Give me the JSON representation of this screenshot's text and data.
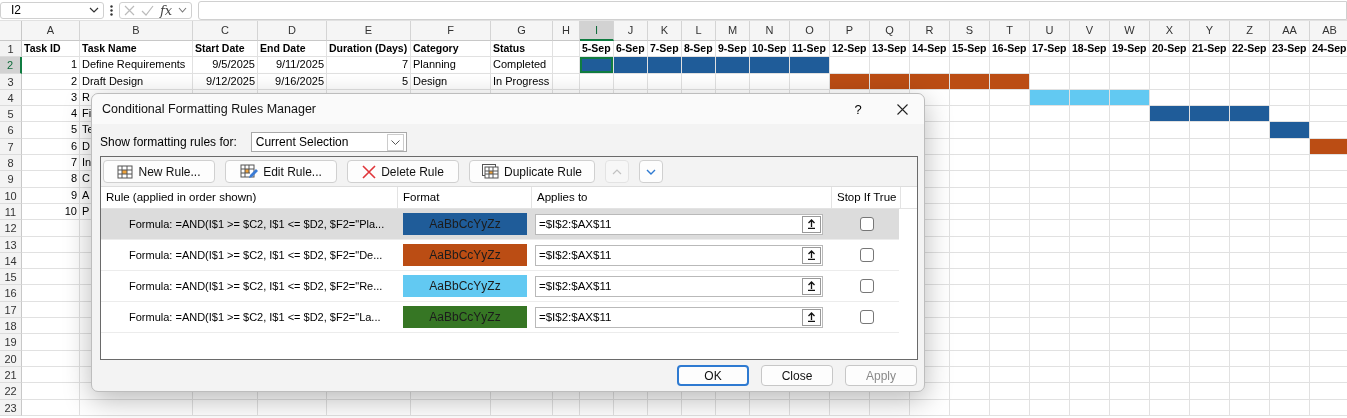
{
  "name_box": {
    "value": "I2"
  },
  "formula_bar": {
    "function_label": "fx"
  },
  "columns": [
    {
      "label": "A",
      "selected": false
    },
    {
      "label": "B",
      "selected": false
    },
    {
      "label": "C",
      "selected": false
    },
    {
      "label": "D",
      "selected": false
    },
    {
      "label": "E",
      "selected": false
    },
    {
      "label": "F",
      "selected": false
    },
    {
      "label": "G",
      "selected": false
    },
    {
      "label": "H",
      "selected": false
    },
    {
      "label": "I",
      "selected": true
    },
    {
      "label": "J",
      "selected": false
    },
    {
      "label": "K",
      "selected": false
    },
    {
      "label": "L",
      "selected": false
    },
    {
      "label": "M",
      "selected": false
    },
    {
      "label": "N",
      "selected": false
    },
    {
      "label": "O",
      "selected": false
    },
    {
      "label": "P",
      "selected": false
    },
    {
      "label": "Q",
      "selected": false
    },
    {
      "label": "R",
      "selected": false
    },
    {
      "label": "S",
      "selected": false
    },
    {
      "label": "T",
      "selected": false
    },
    {
      "label": "U",
      "selected": false
    },
    {
      "label": "V",
      "selected": false
    },
    {
      "label": "W",
      "selected": false
    },
    {
      "label": "X",
      "selected": false
    },
    {
      "label": "Y",
      "selected": false
    },
    {
      "label": "Z",
      "selected": false
    },
    {
      "label": "AA",
      "selected": false
    },
    {
      "label": "AB",
      "selected": false
    }
  ],
  "rows": [
    {
      "number": "1",
      "selected": false,
      "cells": [
        {
          "text": "Task ID",
          "kind": "header"
        },
        {
          "text": "Task Name",
          "kind": "header"
        },
        {
          "text": "Start Date",
          "kind": "header"
        },
        {
          "text": "End Date",
          "kind": "header"
        },
        {
          "text": "Duration (Days)",
          "kind": "header"
        },
        {
          "text": "Category",
          "kind": "header"
        },
        {
          "text": "Status",
          "kind": "header"
        },
        null,
        {
          "text": "5-Sep",
          "kind": "header"
        },
        {
          "text": "6-Sep",
          "kind": "header"
        },
        {
          "text": "7-Sep",
          "kind": "header"
        },
        {
          "text": "8-Sep",
          "kind": "header"
        },
        {
          "text": "9-Sep",
          "kind": "header"
        },
        {
          "text": "10-Sep",
          "kind": "header"
        },
        {
          "text": "11-Sep",
          "kind": "header"
        },
        {
          "text": "12-Sep",
          "kind": "header"
        },
        {
          "text": "13-Sep",
          "kind": "header"
        },
        {
          "text": "14-Sep",
          "kind": "header"
        },
        {
          "text": "15-Sep",
          "kind": "header"
        },
        {
          "text": "16-Sep",
          "kind": "header"
        },
        {
          "text": "17-Sep",
          "kind": "header"
        },
        {
          "text": "18-Sep",
          "kind": "header"
        },
        {
          "text": "19-Sep",
          "kind": "header"
        },
        {
          "text": "20-Sep",
          "kind": "header"
        },
        {
          "text": "21-Sep",
          "kind": "header"
        },
        {
          "text": "22-Sep",
          "kind": "header"
        },
        {
          "text": "23-Sep",
          "kind": "header"
        },
        {
          "text": "24-Sep",
          "kind": "header"
        }
      ]
    },
    {
      "number": "2",
      "selected": true,
      "cells": [
        {
          "text": "1",
          "kind": "number"
        },
        {
          "text": "Define Requirements",
          "kind": "text"
        },
        {
          "text": "9/5/2025",
          "kind": "number"
        },
        {
          "text": "9/11/2025",
          "kind": "number"
        },
        {
          "text": "7",
          "kind": "number"
        },
        {
          "text": "Planning",
          "kind": "text"
        },
        {
          "text": "Completed",
          "kind": "text"
        },
        null,
        {
          "color": "#1f5c99"
        },
        {
          "color": "#1f5c99"
        },
        {
          "color": "#1f5c99"
        },
        {
          "color": "#1f5c99"
        },
        {
          "color": "#1f5c99"
        },
        {
          "color": "#1f5c99"
        },
        {
          "color": "#1f5c99"
        }
      ]
    },
    {
      "number": "3",
      "selected": false,
      "cells": [
        {
          "text": "2",
          "kind": "number"
        },
        {
          "text": "Draft Design",
          "kind": "text"
        },
        {
          "text": "9/12/2025",
          "kind": "number"
        },
        {
          "text": "9/16/2025",
          "kind": "number"
        },
        {
          "text": "5",
          "kind": "number"
        },
        {
          "text": "Design",
          "kind": "text"
        },
        {
          "text": "In Progress",
          "kind": "text"
        },
        null,
        null,
        null,
        null,
        null,
        null,
        null,
        null,
        {
          "color": "#bb4d14"
        },
        {
          "color": "#bb4d14"
        },
        {
          "color": "#bb4d14"
        },
        {
          "color": "#bb4d14"
        },
        {
          "color": "#bb4d14"
        }
      ]
    },
    {
      "number": "4",
      "selected": false,
      "cells": [
        {
          "text": "3",
          "kind": "number"
        },
        {
          "text": "R",
          "kind": "text"
        },
        null,
        null,
        null,
        null,
        null,
        null,
        null,
        null,
        null,
        null,
        null,
        null,
        null,
        null,
        null,
        null,
        null,
        null,
        {
          "color": "#62c9f2"
        },
        {
          "color": "#62c9f2"
        },
        {
          "color": "#62c9f2"
        }
      ]
    },
    {
      "number": "5",
      "selected": false,
      "cells": [
        {
          "text": "4",
          "kind": "number"
        },
        {
          "text": "Fi",
          "kind": "text"
        },
        null,
        null,
        null,
        null,
        null,
        null,
        null,
        null,
        null,
        null,
        null,
        null,
        null,
        null,
        null,
        null,
        null,
        null,
        null,
        null,
        null,
        {
          "color": "#1f5c99"
        },
        {
          "color": "#1f5c99"
        },
        {
          "color": "#1f5c99"
        }
      ]
    },
    {
      "number": "6",
      "selected": false,
      "cells": [
        {
          "text": "5",
          "kind": "number"
        },
        {
          "text": "Te",
          "kind": "text"
        },
        null,
        null,
        null,
        null,
        null,
        null,
        null,
        null,
        null,
        null,
        null,
        null,
        null,
        null,
        null,
        null,
        null,
        null,
        null,
        null,
        null,
        null,
        null,
        null,
        {
          "color": "#1f5c99"
        }
      ]
    },
    {
      "number": "7",
      "selected": false,
      "cells": [
        {
          "text": "6",
          "kind": "number"
        },
        {
          "text": "D",
          "kind": "text"
        },
        null,
        null,
        null,
        null,
        null,
        null,
        null,
        null,
        null,
        null,
        null,
        null,
        null,
        null,
        null,
        null,
        null,
        null,
        null,
        null,
        null,
        null,
        null,
        null,
        null,
        {
          "color": "#bb4d14"
        }
      ]
    },
    {
      "number": "8",
      "selected": false,
      "cells": [
        {
          "text": "7",
          "kind": "number"
        },
        {
          "text": "In",
          "kind": "text"
        }
      ]
    },
    {
      "number": "9",
      "selected": false,
      "cells": [
        {
          "text": "8",
          "kind": "number"
        },
        {
          "text": "C",
          "kind": "text"
        }
      ]
    },
    {
      "number": "10",
      "selected": false,
      "cells": [
        {
          "text": "9",
          "kind": "number"
        },
        {
          "text": "A",
          "kind": "text"
        }
      ]
    },
    {
      "number": "11",
      "selected": false,
      "cells": [
        {
          "text": "10",
          "kind": "number"
        },
        {
          "text": "P",
          "kind": "text"
        }
      ]
    },
    {
      "number": "12",
      "selected": false
    },
    {
      "number": "13",
      "selected": false
    },
    {
      "number": "14",
      "selected": false
    },
    {
      "number": "15",
      "selected": false
    },
    {
      "number": "16",
      "selected": false
    },
    {
      "number": "17",
      "selected": false
    },
    {
      "number": "18",
      "selected": false
    },
    {
      "number": "19",
      "selected": false
    },
    {
      "number": "20",
      "selected": false
    },
    {
      "number": "21",
      "selected": false
    },
    {
      "number": "22",
      "selected": false
    },
    {
      "number": "23",
      "selected": false
    }
  ],
  "dialog": {
    "title": "Conditional Formatting Rules Manager",
    "help_label": "?",
    "show_rules_label": "Show formatting rules for:",
    "scope": {
      "value": "Current Selection"
    },
    "toolbar": [
      {
        "kind": "new",
        "label": "New Rule...",
        "disabled": false
      },
      {
        "kind": "edit",
        "label": "Edit Rule...",
        "disabled": false
      },
      {
        "kind": "delete",
        "label": "Delete Rule",
        "disabled": false
      },
      {
        "kind": "duplicate",
        "label": "Duplicate Rule",
        "disabled": false
      },
      {
        "kind": "up",
        "disabled": true
      },
      {
        "kind": "down",
        "disabled": false
      }
    ],
    "rule_columns": [
      "Rule (applied in order shown)",
      "Format",
      "Applies to",
      "Stop If True"
    ],
    "rules": [
      {
        "rule": "Formula: =AND(I$1 >= $C2, I$1 <= $D2, $F2=\"Pla...",
        "format_sample": "AaBbCcYyZz",
        "color": "#1f5c99",
        "applies_to": "=$I$2:$AX$11",
        "stop_if_true": false,
        "selected": true
      },
      {
        "rule": "Formula: =AND(I$1 >= $C2, I$1 <= $D2, $F2=\"De...",
        "format_sample": "AaBbCcYyZz",
        "color": "#bb4d14",
        "applies_to": "=$I$2:$AX$11",
        "stop_if_true": false,
        "selected": false
      },
      {
        "rule": "Formula: =AND(I$1 >= $C2, I$1 <= $D2, $F2=\"Re...",
        "format_sample": "AaBbCcYyZz",
        "color": "#62c9f2",
        "applies_to": "=$I$2:$AX$11",
        "stop_if_true": false,
        "selected": false
      },
      {
        "rule": "Formula: =AND(I$1 >= $C2, I$1 <= $D2, $F2=\"La...",
        "format_sample": "AaBbCcYyZz",
        "color": "#367624",
        "applies_to": "=$I$2:$AX$11",
        "stop_if_true": false,
        "selected": false
      }
    ],
    "footer_buttons": [
      {
        "label": "OK",
        "focused": true,
        "disabled": false
      },
      {
        "label": "Close",
        "focused": false,
        "disabled": false
      },
      {
        "label": "Apply",
        "focused": false,
        "disabled": true
      }
    ]
  }
}
